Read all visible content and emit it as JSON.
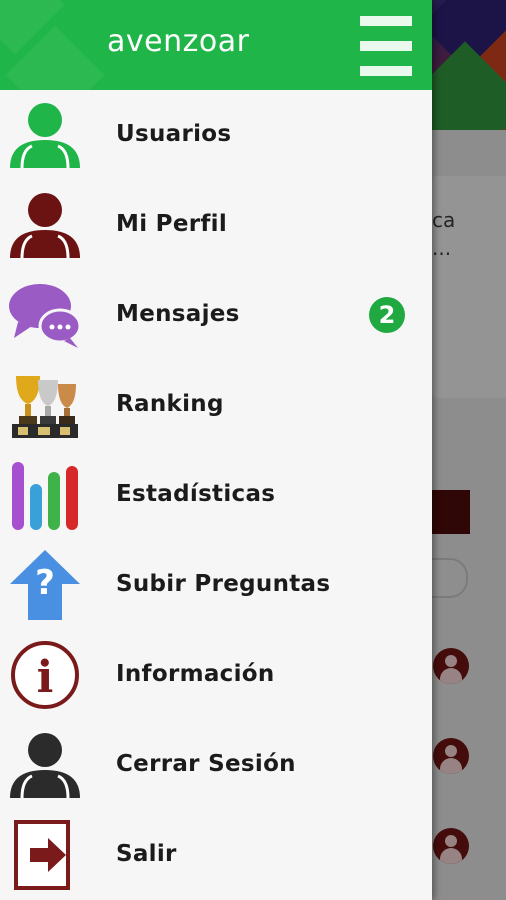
{
  "app": {
    "title": "avenzoar"
  },
  "colors": {
    "brand_green": "#1fb548",
    "user_green": "#1fb548",
    "profile_maroon": "#6b1212",
    "messages_purple": "#9a5bc4",
    "upload_blue": "#4a90e2",
    "info_maroon": "#7a1a1a",
    "logout_black": "#2b2b2b",
    "badge_green": "#1fa940"
  },
  "drawer": {
    "menu_icon": "hamburger-icon",
    "items": [
      {
        "label": "Usuarios",
        "icon": "users-icon"
      },
      {
        "label": "Mi Perfil",
        "icon": "profile-icon"
      },
      {
        "label": "Mensajes",
        "icon": "messages-icon",
        "badge": "2"
      },
      {
        "label": "Ranking",
        "icon": "trophies-icon"
      },
      {
        "label": "Estadísticas",
        "icon": "stats-icon"
      },
      {
        "label": "Subir Preguntas",
        "icon": "upload-question-icon"
      },
      {
        "label": "Información",
        "icon": "info-icon"
      },
      {
        "label": "Cerrar Sesión",
        "icon": "logout-user-icon"
      },
      {
        "label": "Salir",
        "icon": "exit-icon"
      }
    ]
  },
  "background": {
    "card_text_line1": "ca",
    "card_text_line2": "..."
  }
}
